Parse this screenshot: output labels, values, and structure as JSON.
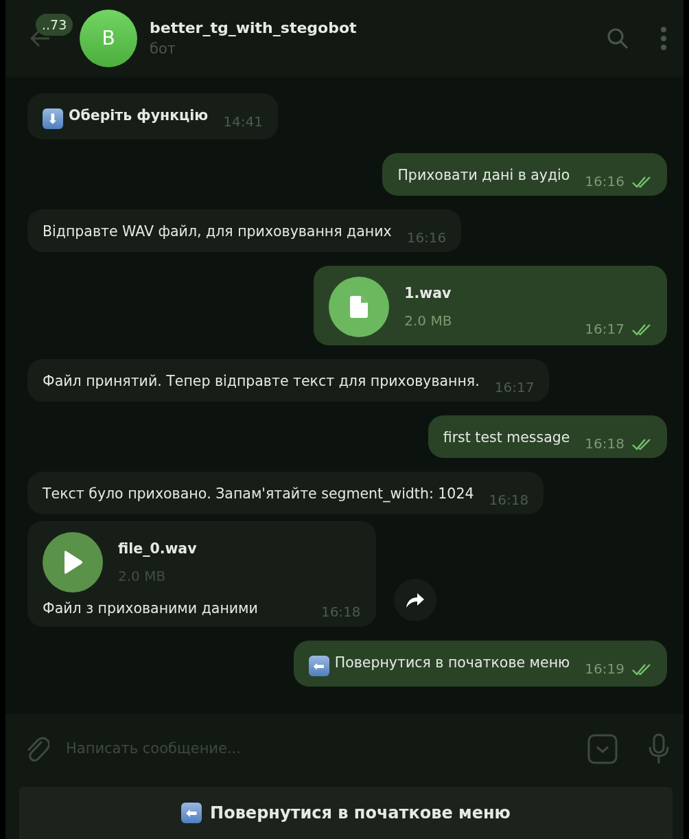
{
  "header": {
    "unread_badge": "..73",
    "avatar_letter": "B",
    "title": "better_tg_with_stegobot",
    "subtitle": "бот"
  },
  "messages": [
    {
      "kind": "text",
      "outgoing": false,
      "emoji": "⬇",
      "text": "Оберіть функцію",
      "bold": true,
      "time": "14:41"
    },
    {
      "kind": "text",
      "outgoing": true,
      "text": "Приховати дані в аудіо",
      "bold": false,
      "time": "16:16",
      "read": true
    },
    {
      "kind": "text",
      "outgoing": false,
      "text": "Відправте WAV файл, для приховування даних",
      "bold": false,
      "time": "16:16"
    },
    {
      "kind": "file",
      "outgoing": true,
      "name": "1.wav",
      "size": "2.0 MB",
      "time": "16:17",
      "read": true
    },
    {
      "kind": "text",
      "outgoing": false,
      "text": "Файл принятий. Тепер відправте текст для приховування.",
      "bold": false,
      "time": "16:17"
    },
    {
      "kind": "text",
      "outgoing": true,
      "text": "first test message",
      "bold": false,
      "time": "16:18",
      "read": true
    },
    {
      "kind": "text",
      "outgoing": false,
      "text": "Текст було приховано. Запам'ятайте segment_width: 1024",
      "bold": false,
      "time": "16:18"
    },
    {
      "kind": "audio",
      "outgoing": false,
      "name": "file_0.wav",
      "size": "2.0 MB",
      "caption": "Файл з прихованими даними",
      "time": "16:18"
    },
    {
      "kind": "text",
      "outgoing": true,
      "emoji": "⬅",
      "text": "Повернутися в початкове меню",
      "bold": false,
      "time": "16:19",
      "read": true
    }
  ],
  "composer": {
    "placeholder": "Написать сообщение..."
  },
  "keyboard": [
    {
      "emoji": "⬅",
      "label": "Повернутися в початкове меню"
    }
  ]
}
